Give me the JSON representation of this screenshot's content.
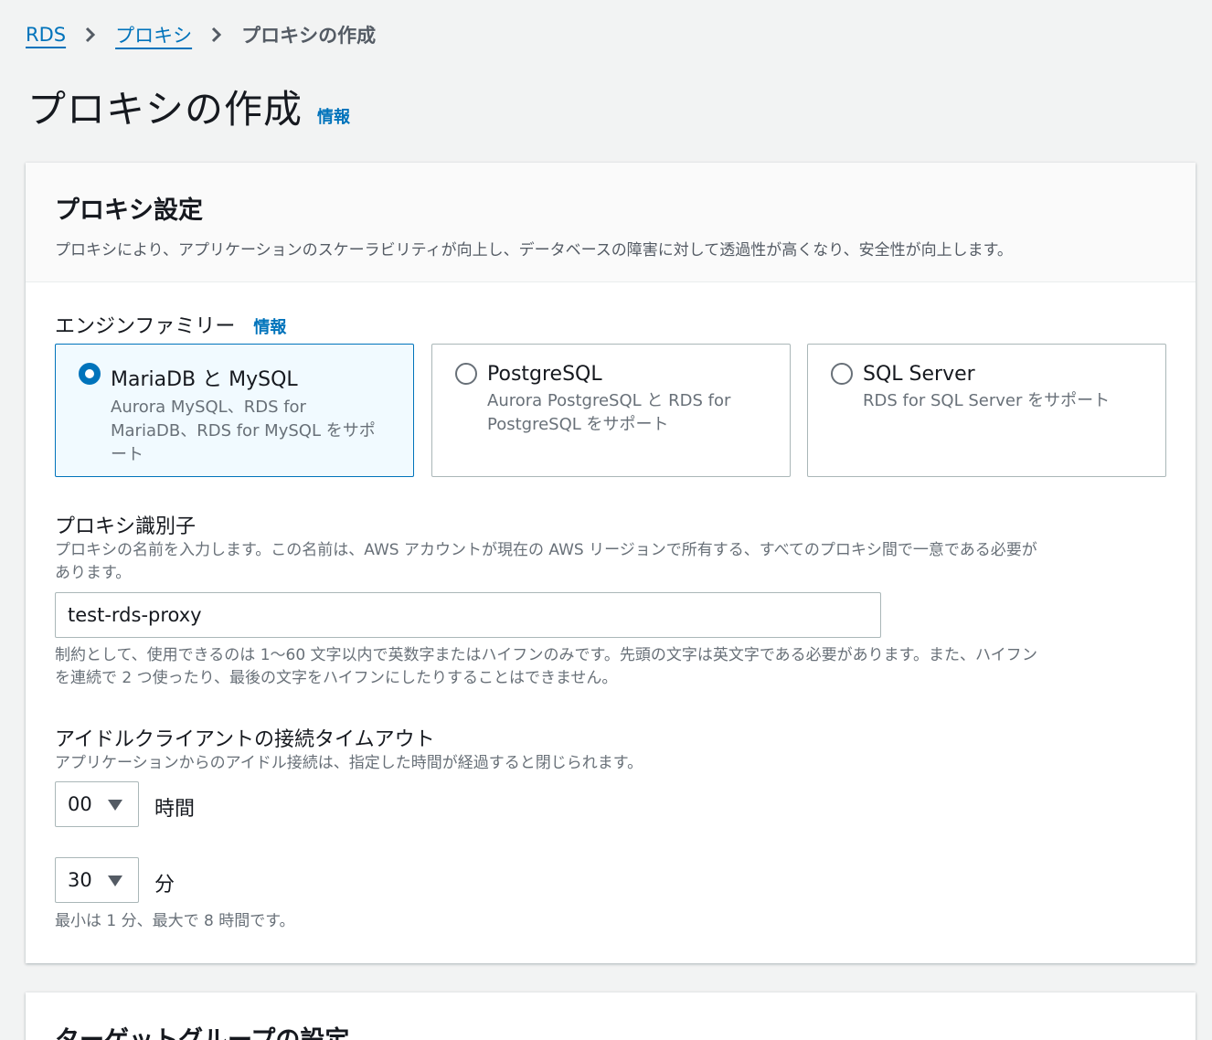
{
  "breadcrumb": {
    "items": [
      "RDS",
      "プロキシ"
    ],
    "current": "プロキシの作成"
  },
  "page": {
    "title": "プロキシの作成",
    "info": "情報"
  },
  "proxy_settings": {
    "title": "プロキシ設定",
    "description": "プロキシにより、アプリケーションのスケーラビリティが向上し、データベースの障害に対して透過性が高くなり、安全性が向上します。",
    "engine_family": {
      "label": "エンジンファミリー",
      "info": "情報",
      "selected": "MariaDB と MySQL",
      "options": [
        {
          "title": "MariaDB と MySQL",
          "desc_lines": [
            "Aurora MySQL、RDS for",
            "MariaDB、RDS for MySQL をサポ",
            "ート"
          ]
        },
        {
          "title": "PostgreSQL",
          "desc_lines": [
            "Aurora PostgreSQL と RDS for",
            "PostgreSQL をサポート"
          ]
        },
        {
          "title": "SQL Server",
          "desc_lines": [
            "RDS for SQL Server をサポート"
          ]
        }
      ]
    },
    "identifier": {
      "label": "プロキシ識別子",
      "desc_line1": "プロキシの名前を入力します。この名前は、AWS アカウントが現在の AWS リージョンで所有する、すべてのプロキシ間で一意である必要が",
      "desc_line2": "あります。",
      "value": "test-rds-proxy",
      "constraint_line1": "制約として、使用できるのは 1〜60 文字以内で英数字またはハイフンのみです。先頭の文字は英文字である必要があります。また、ハイフン",
      "constraint_line2": "を連続で 2 つ使ったり、最後の文字をハイフンにしたりすることはできません。"
    },
    "idle_timeout": {
      "label": "アイドルクライアントの接続タイムアウト",
      "description": "アプリケーションからのアイドル接続は、指定した時間が経過すると閉じられます。",
      "hours_value": "00",
      "hours_unit": "時間",
      "minutes_value": "30",
      "minutes_unit": "分",
      "constraint": "最小は 1 分、最大で 8 時間です。"
    }
  },
  "target_group": {
    "title": "ターゲットグループの設定"
  },
  "colors": {
    "link": "#0073bb",
    "background": "#f2f3f3",
    "selected_tile_bg": "#f1faff",
    "muted_text": "#687078"
  },
  "icons": {
    "breadcrumb_separator": "chevron-right-icon",
    "select_caret": "caret-down-icon",
    "radio": "radio-icon"
  }
}
